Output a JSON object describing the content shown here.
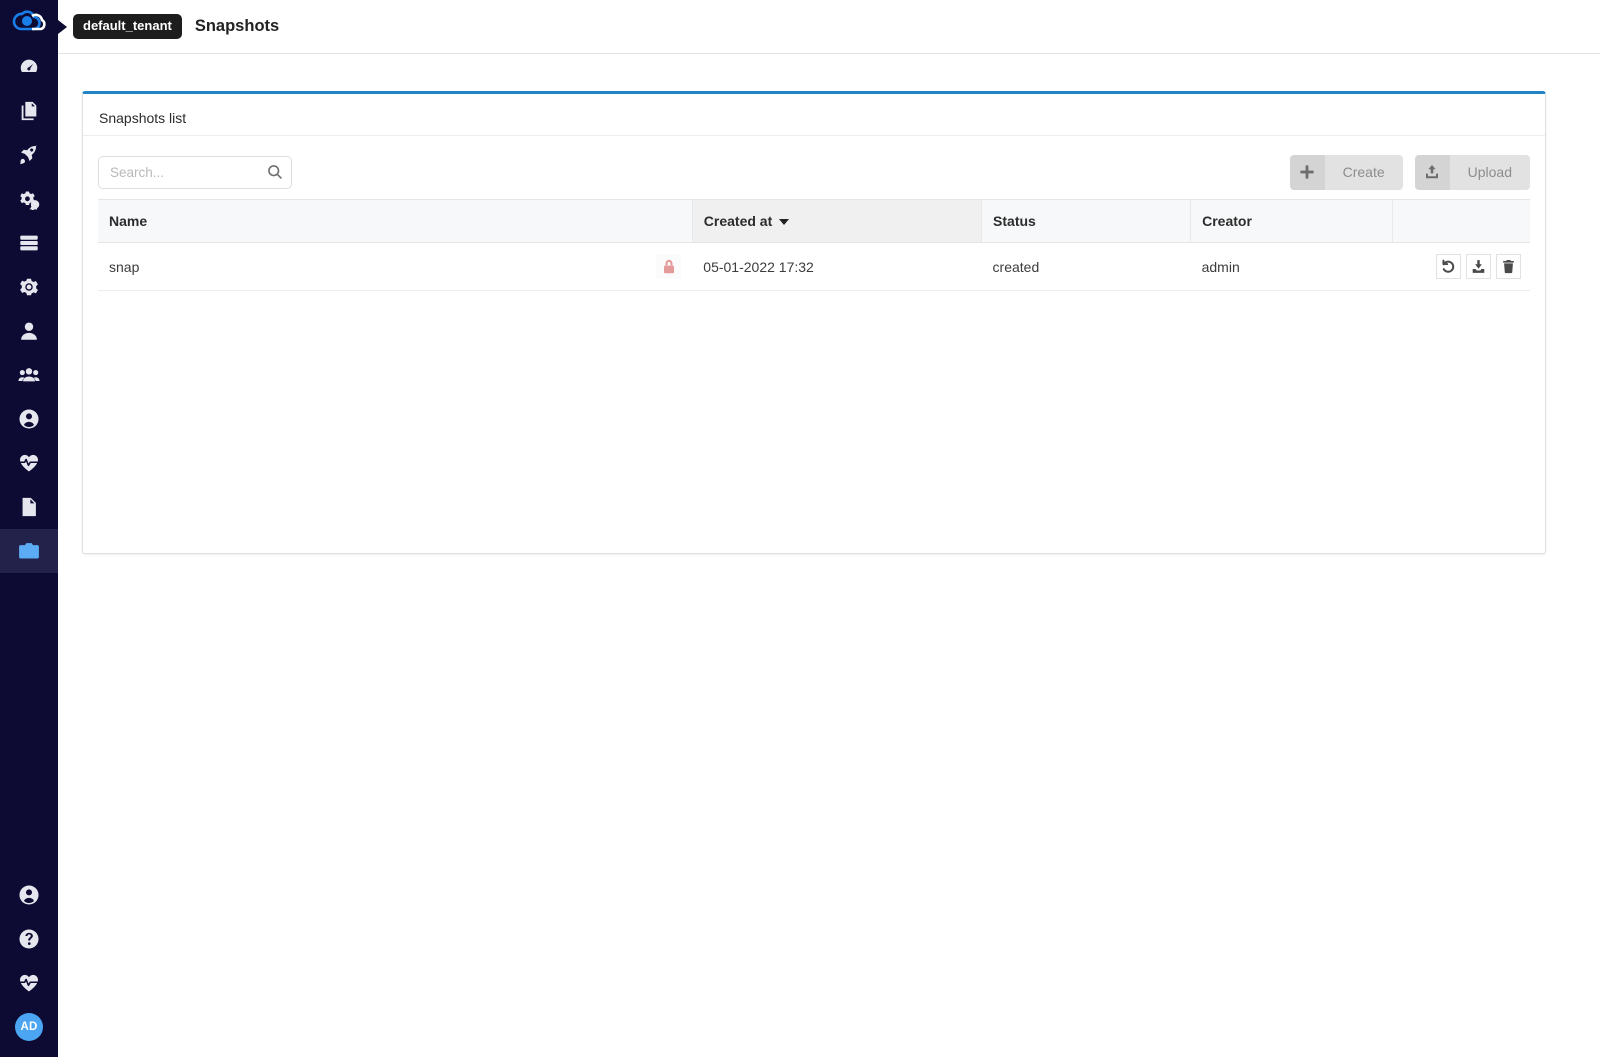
{
  "colors": {
    "sidebar_bg": "#0d0b33",
    "sidebar_active_bg": "#22224a",
    "accent_blue": "#2185c5",
    "icon_active": "#5bacf5",
    "avatar_bg": "#4ca5f2",
    "lock_red": "#e59a9a"
  },
  "sidebar": {
    "logo_icon": "cloud-logo-icon",
    "items": [
      {
        "icon": "dashboard-gauge-icon",
        "name": "dashboard",
        "active": false
      },
      {
        "icon": "blueprints-copy-icon",
        "name": "blueprints",
        "active": false
      },
      {
        "icon": "deployments-rocket-icon",
        "name": "deployments",
        "active": false
      },
      {
        "icon": "services-gears-icon",
        "name": "services",
        "active": false
      },
      {
        "icon": "database-server-icon",
        "name": "system-resources",
        "active": false
      },
      {
        "icon": "settings-gear-icon",
        "name": "settings",
        "active": false
      },
      {
        "icon": "user-icon",
        "name": "user-management",
        "active": false
      },
      {
        "icon": "users-group-icon",
        "name": "tenants",
        "active": false
      },
      {
        "icon": "user-circle-icon",
        "name": "user-groups",
        "active": false
      },
      {
        "icon": "heartbeat-icon",
        "name": "system-health",
        "active": false
      },
      {
        "icon": "document-icon",
        "name": "logs",
        "active": false
      },
      {
        "icon": "camera-icon",
        "name": "snapshots",
        "active": true
      }
    ],
    "bottom_items": [
      {
        "icon": "user-circle-icon",
        "name": "account"
      },
      {
        "icon": "help-question-icon",
        "name": "help"
      },
      {
        "icon": "heartbeat-icon",
        "name": "status"
      }
    ],
    "avatar_initials": "AD"
  },
  "topbar": {
    "tenant_badge": "default_tenant",
    "page_title": "Snapshots"
  },
  "panel": {
    "header": "Snapshots list"
  },
  "search": {
    "placeholder": "Search...",
    "value": "",
    "icon": "search-icon"
  },
  "toolbar": {
    "create_label": "Create",
    "create_icon": "plus-icon",
    "upload_label": "Upload",
    "upload_icon": "upload-icon"
  },
  "table": {
    "columns": [
      {
        "label": "Name",
        "sorted": false
      },
      {
        "label": "Created at",
        "sorted": true,
        "sort_direction": "desc"
      },
      {
        "label": "Status",
        "sorted": false
      },
      {
        "label": "Creator",
        "sorted": false
      },
      {
        "label": "",
        "sorted": false
      }
    ],
    "rows": [
      {
        "name": "snap",
        "lock_icon": "lock-icon",
        "created_at": "05-01-2022 17:32",
        "status": "created",
        "creator": "admin",
        "actions": [
          {
            "icon": "restore-undo-icon",
            "name": "restore-snapshot-button"
          },
          {
            "icon": "download-icon",
            "name": "download-snapshot-button"
          },
          {
            "icon": "trash-icon",
            "name": "delete-snapshot-button"
          }
        ]
      }
    ]
  }
}
